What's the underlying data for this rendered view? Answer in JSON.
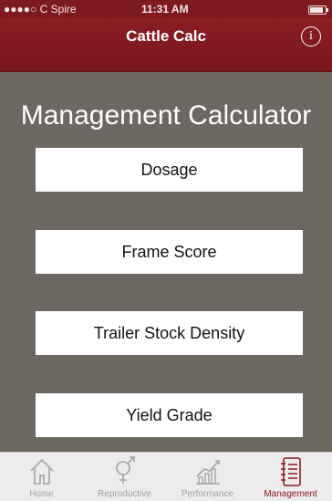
{
  "status_bar": {
    "carrier": "●●●●○ C Spire",
    "time": "11:31 AM"
  },
  "nav": {
    "title": "Cattle Calc",
    "info_glyph": "i"
  },
  "page_title": "Management Calculator",
  "menu": [
    {
      "label": "Dosage"
    },
    {
      "label": "Frame Score"
    },
    {
      "label": "Trailer Stock Density"
    },
    {
      "label": "Yield Grade"
    }
  ],
  "tabs": [
    {
      "label": "Home",
      "icon": "house-icon",
      "active": false
    },
    {
      "label": "Reproductive",
      "icon": "gender-symbol-icon",
      "active": false
    },
    {
      "label": "Performance",
      "icon": "bar-chart-icon",
      "active": false
    },
    {
      "label": "Management",
      "icon": "notebook-list-icon",
      "active": true
    }
  ],
  "colors": {
    "brand": "#7d1a20",
    "background": "#6e6862",
    "tab_inactive": "#a4a4a4"
  }
}
